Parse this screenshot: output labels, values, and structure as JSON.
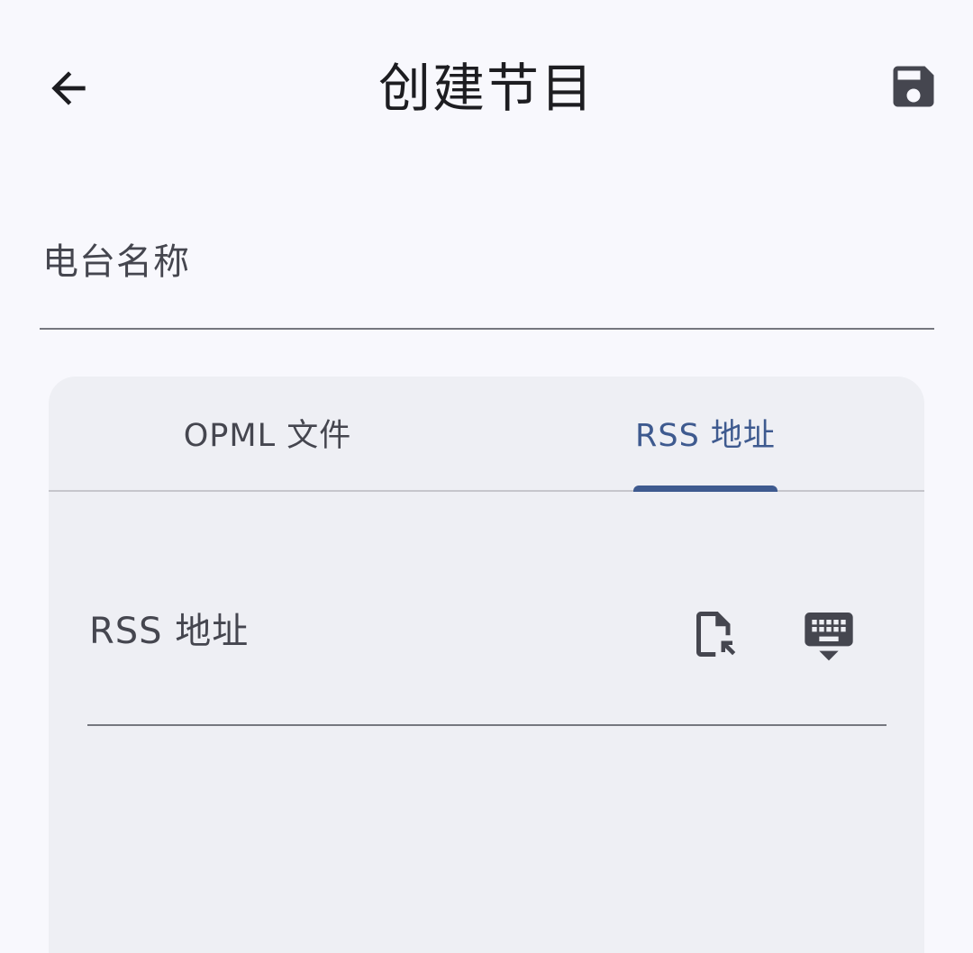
{
  "header": {
    "title": "创建节目",
    "back_icon": "arrow-back-icon",
    "save_icon": "save-icon"
  },
  "form": {
    "station_name_label": "电台名称"
  },
  "tabs": [
    {
      "label": "OPML 文件",
      "selected": false
    },
    {
      "label": "RSS 地址",
      "selected": true
    }
  ],
  "rss": {
    "field_label": "RSS 地址",
    "file_icon": "file-select-icon",
    "keyboard_icon": "keyboard-hide-icon"
  },
  "colors": {
    "background": "#f8f8fd",
    "card": "#eeeff4",
    "accent": "#3e5a8f",
    "icon": "#45464f",
    "text": "#1d1d21"
  }
}
